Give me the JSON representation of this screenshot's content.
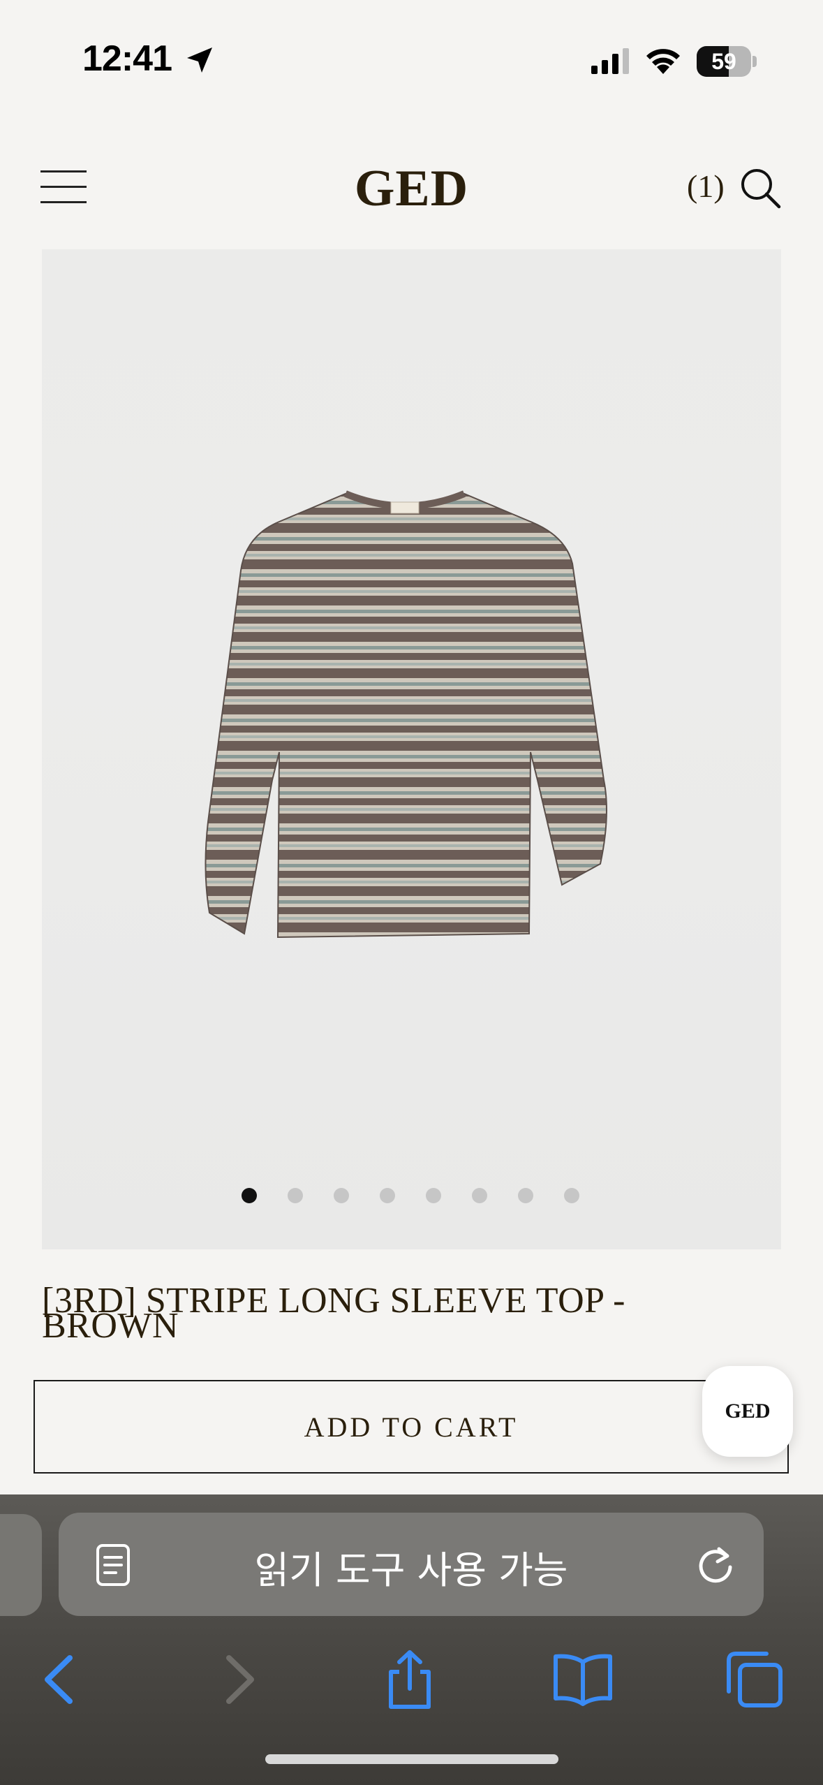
{
  "status_bar": {
    "time": "12:41",
    "battery_level": 59,
    "battery_text": "59"
  },
  "header": {
    "logo": "GED",
    "cart_count": "(1)"
  },
  "gallery": {
    "slide_count": 8,
    "active_slide": 1
  },
  "product": {
    "title_line1": "[3RD] STRIPE LONG SLEEVE TOP -",
    "title_line2": "BROWN",
    "add_to_cart_label": "ADD TO CART"
  },
  "chat": {
    "label": "GED"
  },
  "browser": {
    "address_text": "읽기 도구 사용 가능",
    "accent_color": "#3a8bf5"
  },
  "icons": {
    "menu": "hamburger-menu-icon",
    "search": "search-icon",
    "reader": "reader-mode-icon",
    "reload": "reload-icon",
    "back": "chevron-left-icon",
    "forward": "chevron-right-icon",
    "share": "share-icon",
    "bookmarks": "book-icon",
    "tabs": "tabs-icon"
  }
}
